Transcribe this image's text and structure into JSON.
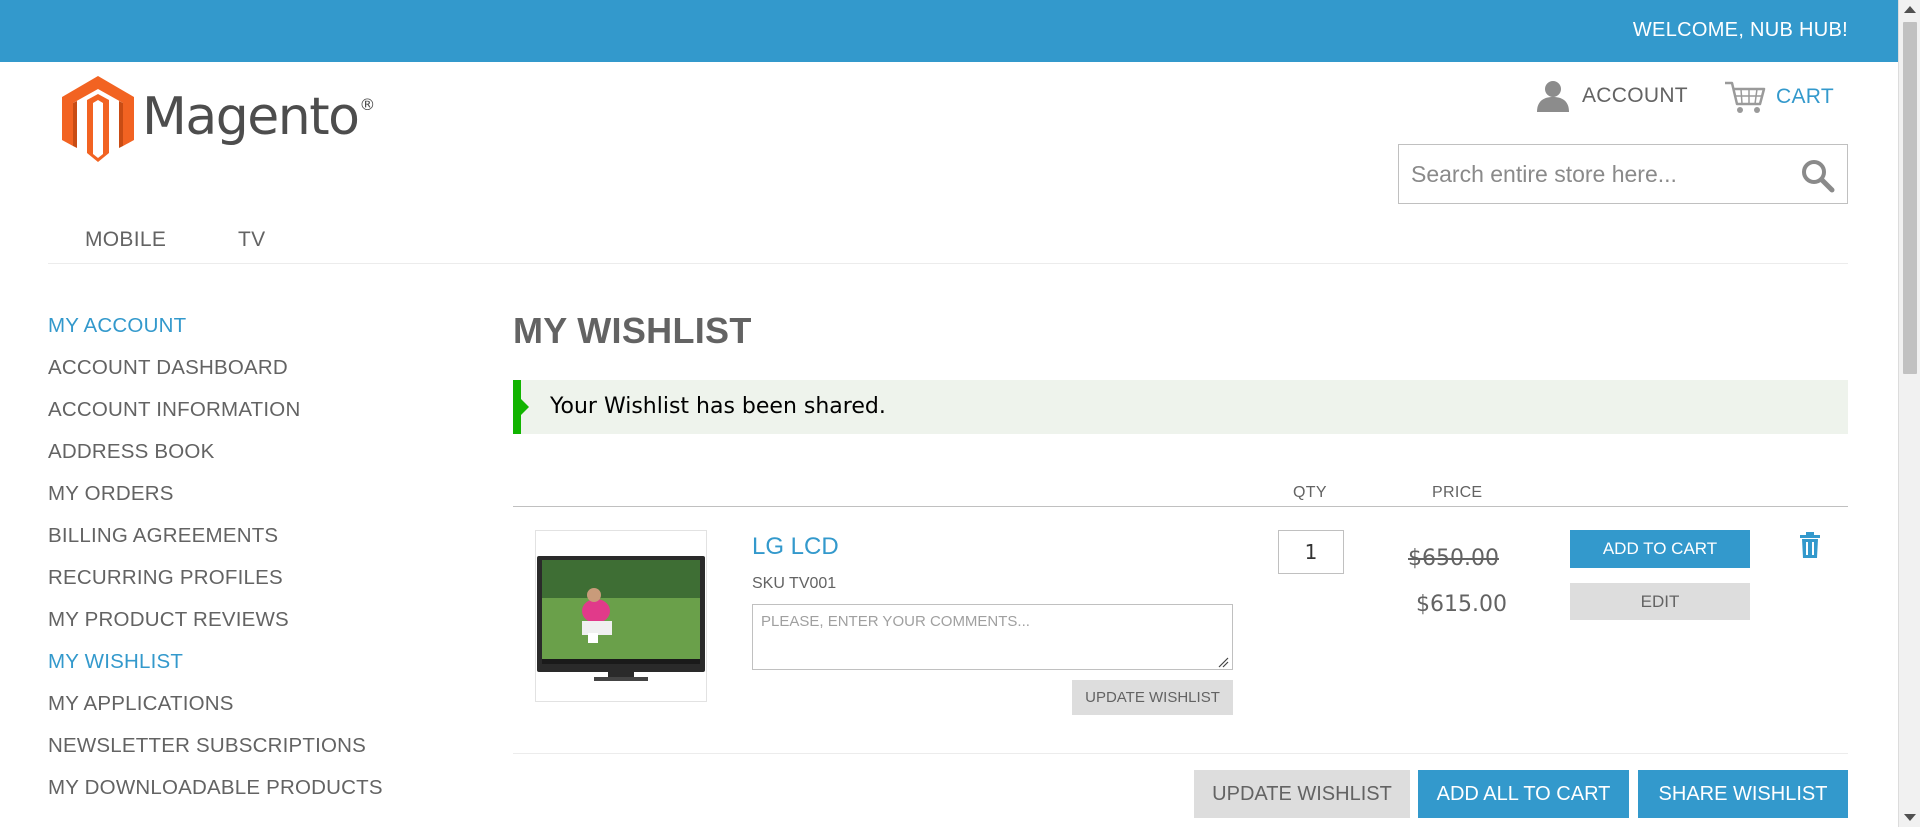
{
  "header": {
    "welcome": "WELCOME, NUB HUB!",
    "logo_text": "Magento",
    "logo_reg": "®",
    "account_label": "ACCOUNT",
    "cart_label": "CART",
    "search_placeholder": "Search entire store here..."
  },
  "nav": {
    "items": [
      "MOBILE",
      "TV"
    ]
  },
  "sidebar": {
    "title": "MY ACCOUNT",
    "items": [
      "ACCOUNT DASHBOARD",
      "ACCOUNT INFORMATION",
      "ADDRESS BOOK",
      "MY ORDERS",
      "BILLING AGREEMENTS",
      "RECURRING PROFILES",
      "MY PRODUCT REVIEWS",
      "MY WISHLIST",
      "MY APPLICATIONS",
      "NEWSLETTER SUBSCRIPTIONS",
      "MY DOWNLOADABLE PRODUCTS"
    ],
    "active_item": "MY WISHLIST"
  },
  "main": {
    "title": "MY WISHLIST",
    "message": "Your Wishlist has been shared.",
    "table_headers": {
      "qty": "QTY",
      "price": "PRICE"
    },
    "item": {
      "name": "LG LCD",
      "sku": "SKU TV001",
      "comment_placeholder": "PLEASE, ENTER YOUR COMMENTS...",
      "update_label": "UPDATE WISHLIST",
      "qty": "1",
      "old_price": "$650.00",
      "price": "$615.00",
      "add_to_cart": "ADD TO CART",
      "edit": "EDIT"
    },
    "actions": {
      "update": "UPDATE WISHLIST",
      "add_all": "ADD ALL TO CART",
      "share": "SHARE WISHLIST"
    }
  },
  "colors": {
    "brand_blue": "#3399cc",
    "success_green": "#11b400",
    "logo_orange": "#f26322"
  }
}
